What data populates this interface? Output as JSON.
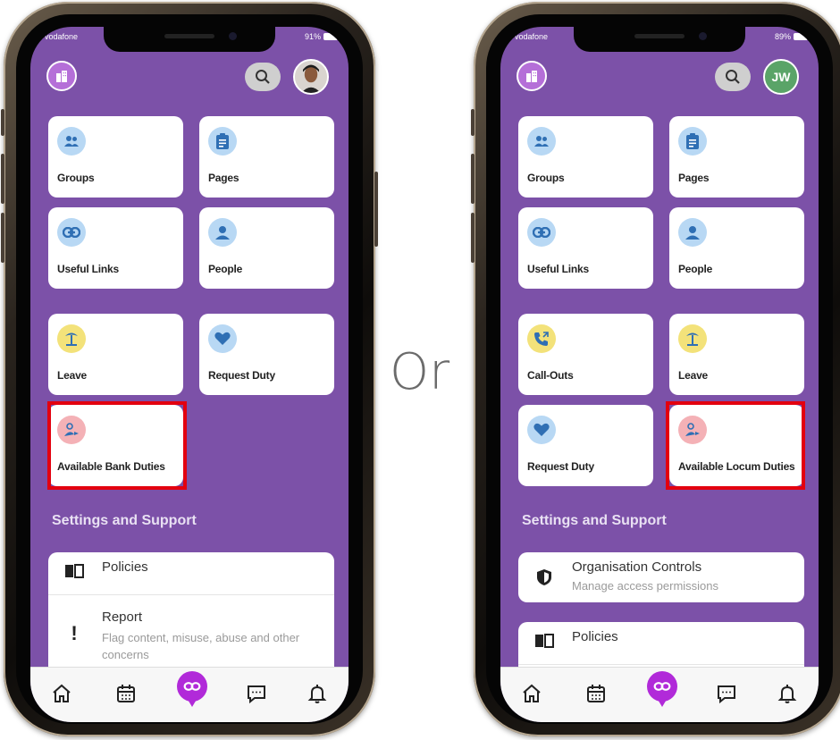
{
  "separator_text": "Or",
  "left": {
    "carrier": "vodafone",
    "battery": "91%",
    "tiles": [
      {
        "label": "Groups",
        "icon": "groups-icon",
        "color": "blue"
      },
      {
        "label": "Pages",
        "icon": "clipboard-icon",
        "color": "blue"
      },
      {
        "label": "Useful Links",
        "icon": "link-icon",
        "color": "blue"
      },
      {
        "label": "People",
        "icon": "person-icon",
        "color": "blue"
      },
      {
        "label": "Leave",
        "icon": "palm-tree-icon",
        "color": "yellow"
      },
      {
        "label": "Request Duty",
        "icon": "heart-icon",
        "color": "blue"
      },
      {
        "label": "Available Bank Duties",
        "icon": "person-switch-icon",
        "color": "pink",
        "highlighted": true
      }
    ],
    "settings_title": "Settings and Support",
    "policies_label": "Policies",
    "report_title": "Report",
    "report_subtitle": "Flag content, misuse, abuse and other concerns"
  },
  "right": {
    "carrier": "vodafone",
    "battery": "89%",
    "avatar_initials": "JW",
    "tiles": [
      {
        "label": "Groups",
        "icon": "groups-icon",
        "color": "blue"
      },
      {
        "label": "Pages",
        "icon": "clipboard-icon",
        "color": "blue"
      },
      {
        "label": "Useful Links",
        "icon": "link-icon",
        "color": "blue"
      },
      {
        "label": "People",
        "icon": "person-icon",
        "color": "blue"
      },
      {
        "label": "Call-Outs",
        "icon": "phone-forward-icon",
        "color": "yellow"
      },
      {
        "label": "Leave",
        "icon": "palm-tree-icon",
        "color": "yellow"
      },
      {
        "label": "Request Duty",
        "icon": "heart-icon",
        "color": "blue"
      },
      {
        "label": "Available Locum Duties",
        "icon": "person-switch-icon",
        "color": "pink",
        "highlighted": true
      }
    ],
    "settings_title": "Settings and Support",
    "org_controls_title": "Organisation Controls",
    "org_controls_subtitle": "Manage access permissions",
    "policies_label": "Policies"
  },
  "colors": {
    "app_purple": "#7c51a8",
    "highlight_red": "#e3000f",
    "hub_magenta": "#b12ad9"
  },
  "nav_icons": [
    "home-icon",
    "calendar-icon",
    "hub-icon",
    "chat-icon",
    "bell-icon"
  ]
}
